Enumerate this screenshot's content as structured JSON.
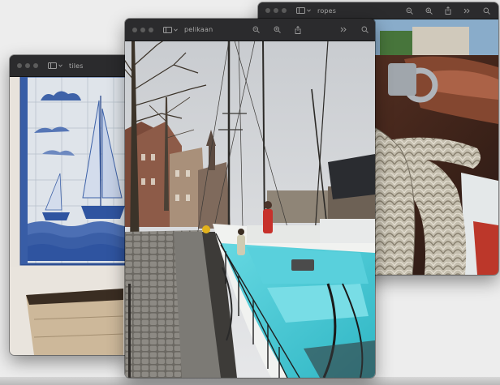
{
  "windows": {
    "ropes": {
      "title": "ropes",
      "icons": [
        "sidebar-icon",
        "chevron-down-icon",
        "zoom-out-icon",
        "zoom-in-icon",
        "share-icon",
        "more-icon",
        "search-icon"
      ]
    },
    "tiles": {
      "title": "tiles",
      "icons": [
        "sidebar-icon",
        "chevron-down-icon"
      ]
    },
    "pelikaan": {
      "title": "pelikaan",
      "icons": [
        "sidebar-icon",
        "chevron-down-icon",
        "zoom-out-icon",
        "zoom-in-icon",
        "share-icon",
        "more-icon",
        "search-icon"
      ]
    }
  },
  "colors": {
    "titlebar": "#2b2b2d",
    "traffic_light": "#5c5c5c",
    "desktop": "#ededed",
    "boat_deck": "#3fc6d3"
  }
}
